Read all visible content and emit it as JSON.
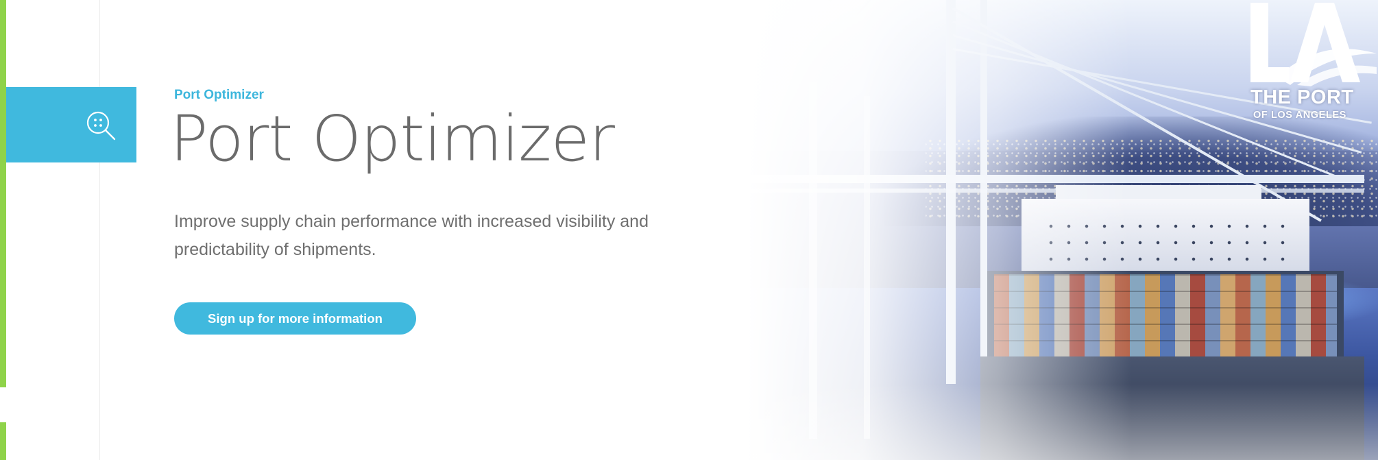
{
  "brand": {
    "logo_line1": "THE PORT",
    "logo_line2": "OF LOS ANGELES",
    "accent_color": "#40b9de",
    "rail_color": "#8fd34a"
  },
  "sidebar": {
    "search_icon": "search-icon"
  },
  "hero": {
    "eyebrow": "Port Optimizer",
    "title": "Port Optimizer",
    "subtitle": "Improve supply chain performance with increased visibility and predictability of shipments.",
    "cta_label": "Sign up for more information"
  }
}
